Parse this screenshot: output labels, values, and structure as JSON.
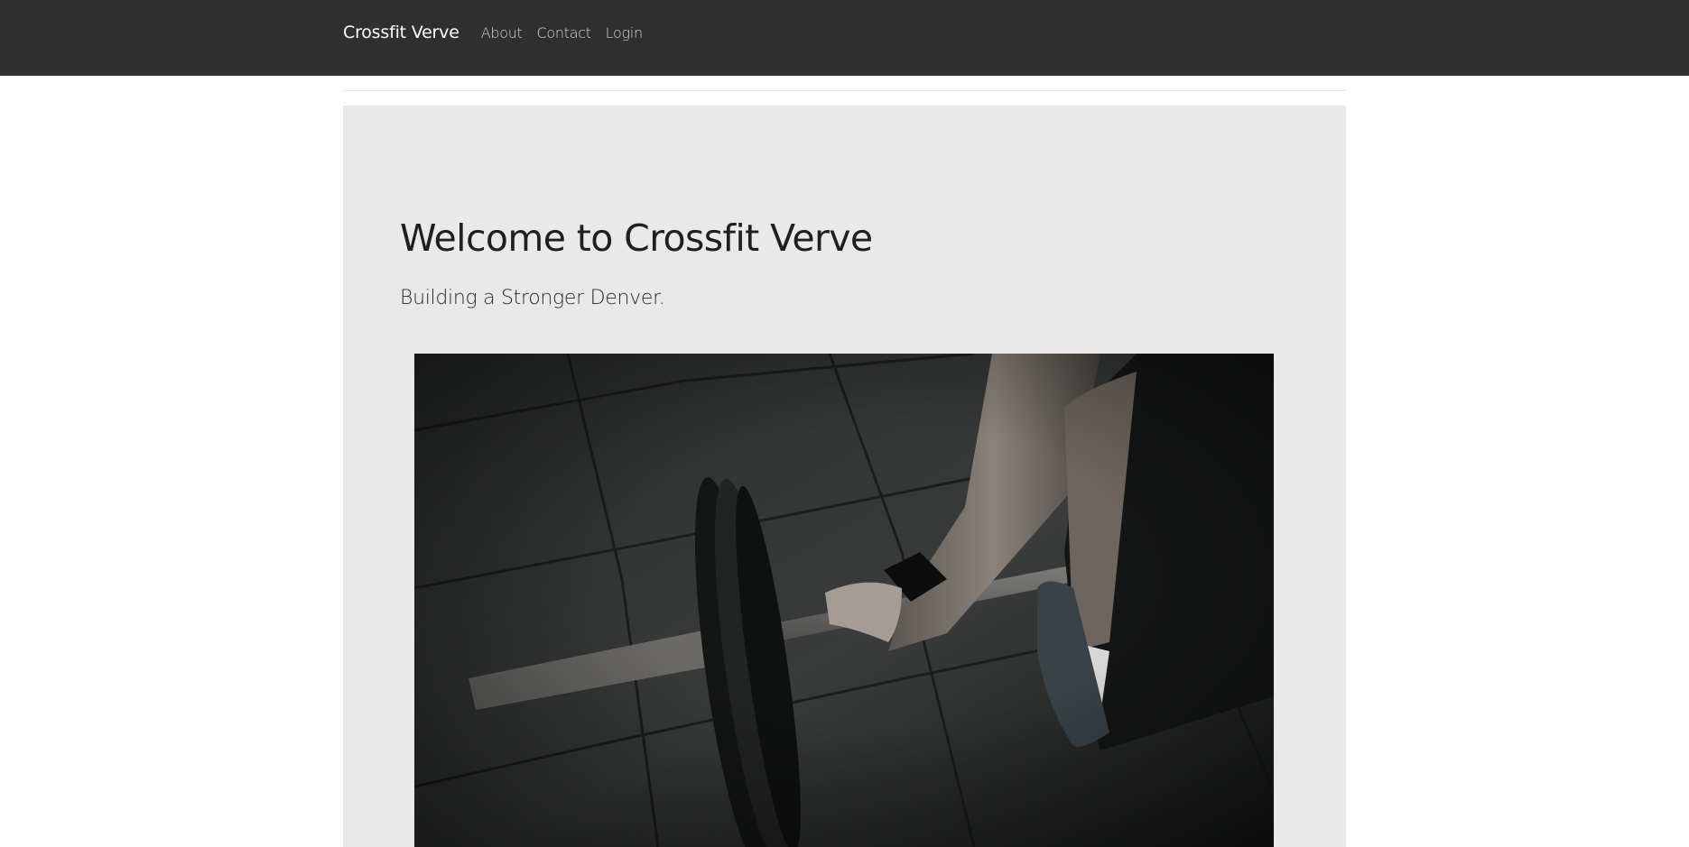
{
  "navbar": {
    "brand": "Crossfit Verve",
    "links": [
      {
        "label": "About"
      },
      {
        "label": "Contact"
      },
      {
        "label": "Login"
      }
    ]
  },
  "hero": {
    "title": "Welcome to Crossfit Verve",
    "subtitle": "Building a Stronger Denver.",
    "image": {
      "subject": "athlete gripping a loaded barbell on a dark gym floor"
    }
  },
  "colors": {
    "navbar_bg": "#2f2f2f",
    "jumbotron_bg": "#e9e9e9",
    "brand_text": "#ffffff",
    "nav_text": "#d4d4d4"
  }
}
